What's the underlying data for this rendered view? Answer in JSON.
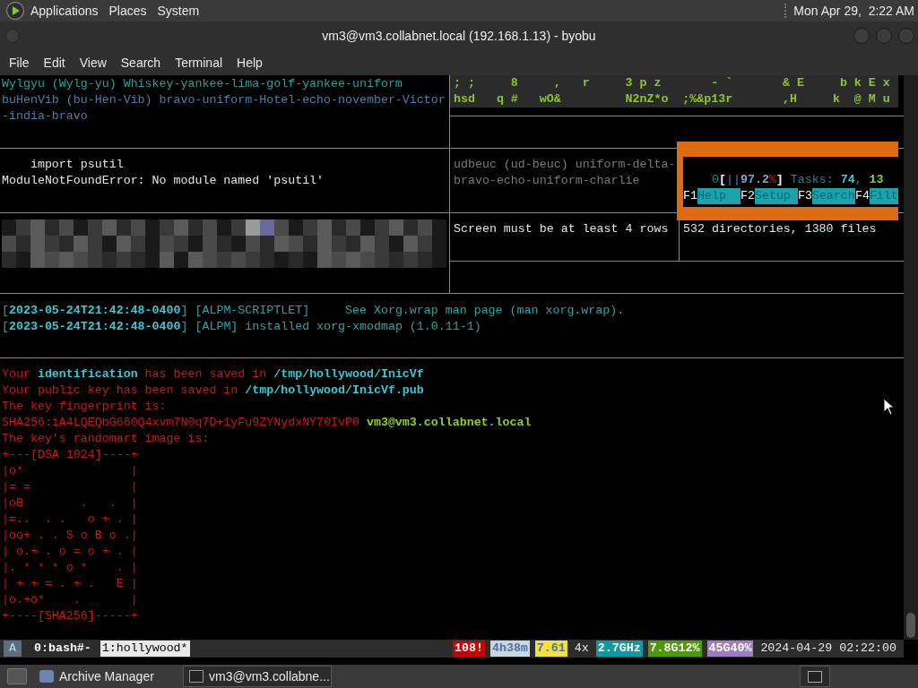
{
  "top_panel": {
    "menus": [
      "Applications",
      "Places",
      "System"
    ],
    "clock": "Mon Apr 29,  2:22 AM"
  },
  "window": {
    "title": "vm3@vm3.collabnet.local (192.168.1.13) - byobu"
  },
  "menu_bar": [
    "File",
    "Edit",
    "View",
    "Search",
    "Terminal",
    "Help"
  ],
  "dictionary_pane": [
    [
      {
        "text": "Wylgyu (Wylg-yu) Whiskey-yankee-lima-golf-yankee-uniform",
        "kind": "word"
      }
    ],
    [
      {
        "text": "buHenVib (bu-Hen-Vib) bravo-uniform-Hotel-echo-november-Victor",
        "kind": "spell"
      }
    ],
    [
      {
        "text": "-india-bravo",
        "kind": "spell"
      }
    ]
  ],
  "chars_pane": [
    "; ;     8     ,   r     3 p z       - `       & E     b k E x",
    "hsd   q #   wO&         N2nZ*o  ;%&p13r       ,H     k  @ M u"
  ],
  "python_pane": [
    [
      {
        "text": "    import psutil",
        "kind": "output"
      }
    ],
    [
      {
        "text": "ModuleNotFoundError: No module named 'psutil'",
        "kind": "output"
      }
    ]
  ],
  "spelling_pane": [
    [
      {
        "text": "udbeuc (ud-beuc) uniform-delta-",
        "kind": "muted"
      }
    ],
    [
      {
        "text": "bravo-echo-uniform-charlie",
        "kind": "muted"
      }
    ]
  ],
  "htop": {
    "meter": [
      {
        "text": "0",
        "kind": "htop-label"
      },
      {
        "text": "[",
        "kind": "htop-bracket"
      },
      {
        "text": "||",
        "kind": "htop-bar"
      },
      {
        "text": "97.2",
        "kind": "htop-value"
      },
      {
        "text": "%",
        "kind": "htop-unit"
      },
      {
        "text": "]",
        "kind": "htop-bracket"
      },
      {
        "text": " Tasks: ",
        "kind": "htop-label"
      },
      {
        "text": "74",
        "kind": "htop-count"
      },
      {
        "text": ", ",
        "kind": "htop-label"
      },
      {
        "text": "13",
        "kind": "htop-running"
      }
    ],
    "keys": [
      {
        "key": "F1",
        "label": "Help"
      },
      {
        "key": "F2",
        "label": "Setup"
      },
      {
        "key": "F3",
        "label": "Search"
      },
      {
        "key": "F4",
        "label": "Filt"
      }
    ]
  },
  "resize_pane": {
    "message": "Screen must be at least 4 rows"
  },
  "tree_pane": {
    "summary": "532 directories, 1380 files"
  },
  "log_pane": [
    [
      {
        "text": "[",
        "kind": "log"
      },
      {
        "text": "2023-05-24T21:42:48-0400",
        "kind": "stamp"
      },
      {
        "text": "] [ALPM-SCRIPTLET]     See Xorg.wrap man page (man xorg.wrap).",
        "kind": "log"
      }
    ],
    [
      {
        "text": "[",
        "kind": "log"
      },
      {
        "text": "2023-05-24T21:42:48-0400",
        "kind": "stamp"
      },
      {
        "text": "] [ALPM] installed xorg-xmodmap (1.0.11-1)",
        "kind": "log"
      }
    ]
  ],
  "keygen_pane": [
    [
      {
        "text": "Your ",
        "kind": "key"
      },
      {
        "text": "identification",
        "kind": "path"
      },
      {
        "text": " has been saved in ",
        "kind": "key"
      },
      {
        "text": "/tmp/hollywood/InicVf",
        "kind": "path"
      }
    ],
    [
      {
        "text": "Your public key has been saved in ",
        "kind": "key"
      },
      {
        "text": "/tmp/hollywood/InicVf.pub",
        "kind": "path"
      }
    ],
    [
      {
        "text": "The key fingerprint is:",
        "kind": "key"
      }
    ],
    [
      {
        "text": "SHA256:iA4LQEQbG660Q4xvm7N0q7D+1yFu9ZYNydxNY70IvP0 ",
        "kind": "key"
      },
      {
        "text": "vm3@vm3.collabnet.local",
        "kind": "host"
      }
    ],
    [
      {
        "text": "The key's randomart image is:",
        "kind": "key"
      }
    ],
    [
      {
        "text": "+---[DSA 1024]----+",
        "kind": "key"
      }
    ],
    [
      {
        "text": "|o*               |",
        "kind": "key"
      }
    ],
    [
      {
        "text": "|= =              |",
        "kind": "key"
      }
    ],
    [
      {
        "text": "|oB        .   .  |",
        "kind": "key"
      }
    ],
    [
      {
        "text": "|=..  . .   o + . |",
        "kind": "key"
      }
    ],
    [
      {
        "text": "|oo+ . . S o B o .|",
        "kind": "key"
      }
    ],
    [
      {
        "text": "| o.+ . o = o + . |",
        "kind": "key"
      }
    ],
    [
      {
        "text": "|. * * * o *    . |",
        "kind": "key"
      }
    ],
    [
      {
        "text": "| + + = . + .   E |",
        "kind": "key"
      }
    ],
    [
      {
        "text": "|o.+o*    .       |",
        "kind": "key"
      }
    ],
    [
      {
        "text": "+----[SHA256]-----+",
        "kind": "key"
      }
    ]
  ],
  "status_bar": {
    "session": "A",
    "windows": [
      {
        "label": "0:bash#-",
        "selected": false
      },
      {
        "label": "1:hollywood*",
        "selected": true
      }
    ],
    "segments": [
      {
        "text": "108!",
        "color": "#cc0000"
      },
      {
        "text": "4h38m",
        "color": "#c9d6de"
      },
      {
        "text": "7.61",
        "color": "#f0e040"
      },
      {
        "text": "4x"
      },
      {
        "text": "2.7GHz",
        "color": "#0e9aa0"
      },
      {
        "text": "7.8G12%",
        "color": "#4e9a06"
      },
      {
        "text": "45G40%",
        "color": "#a07cc0"
      },
      {
        "text": "2024-04-29 02:22:00"
      }
    ]
  },
  "taskbar": {
    "items": [
      {
        "label": "Archive Manager",
        "selected": false
      },
      {
        "label": "vm3@vm3.collabne...",
        "selected": true
      }
    ]
  }
}
